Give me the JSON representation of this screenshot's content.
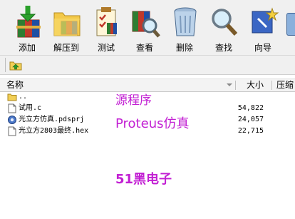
{
  "toolbar": {
    "buttons": [
      {
        "label": "添加",
        "icon": "add-archive-icon"
      },
      {
        "label": "解压到",
        "icon": "extract-to-icon"
      },
      {
        "label": "测试",
        "icon": "test-icon"
      },
      {
        "label": "查看",
        "icon": "view-icon"
      },
      {
        "label": "删除",
        "icon": "delete-icon"
      },
      {
        "label": "查找",
        "icon": "find-icon"
      },
      {
        "label": "向导",
        "icon": "wizard-icon"
      }
    ]
  },
  "columns": {
    "name": "名称",
    "size": "大小",
    "compressed": "压缩"
  },
  "files": [
    {
      "name": "..",
      "size": "",
      "icon": "folder-up-icon"
    },
    {
      "name": "试用.c",
      "size": "54,822",
      "icon": "c-file-icon"
    },
    {
      "name": "光立方仿真.pdsprj",
      "size": "24,057",
      "icon": "proteus-file-icon"
    },
    {
      "name": "光立方2803最终.hex",
      "size": "22,715",
      "icon": "hex-file-icon"
    }
  ],
  "annotations": {
    "source": "源程序",
    "proteus": "Proteus仿真",
    "brand": "51黑电子"
  },
  "colors": {
    "annotation": "#c21fd3",
    "toolbar_bg": "#f0f0f0"
  }
}
